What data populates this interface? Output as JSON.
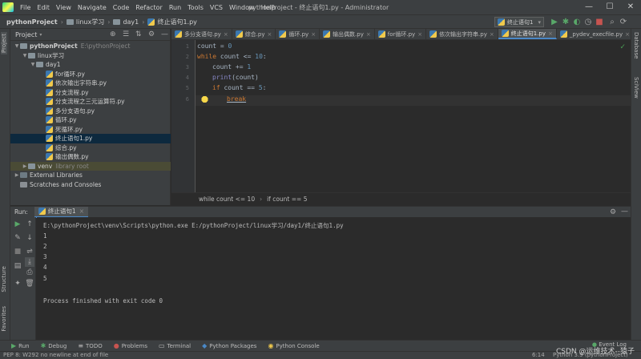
{
  "window": {
    "title": "pythonProject - 终止语句1.py - Administrator",
    "menu": [
      "File",
      "Edit",
      "View",
      "Navigate",
      "Code",
      "Refactor",
      "Run",
      "Tools",
      "VCS",
      "Window",
      "Help"
    ],
    "minimize": "—",
    "maximize": "☐",
    "close": "✕"
  },
  "navbar": {
    "crumbs": [
      "pythonProject",
      "linux学习",
      "day1",
      "终止语句1.py"
    ],
    "run_config": "终止语句1"
  },
  "project_panel": {
    "title": "Project",
    "root": "pythonProject",
    "root_path": "E:\\pythonProject",
    "folders": [
      "linux学习",
      "day1"
    ],
    "files": [
      "for循环.py",
      "依次输出字符串.py",
      "分支流程.py",
      "分支流程之三元运算符.py",
      "多分支语句.py",
      "循环.py",
      "死循环.py",
      "终止语句1.py",
      "综合.py",
      "输出偶数.py"
    ],
    "selected_file": "终止语句1.py",
    "venv": "venv",
    "venv_note": "library root",
    "external_libraries": "External Libraries",
    "scratches": "Scratches and Consoles"
  },
  "tool_windows": {
    "left_top": "Project",
    "left_structure": "Structure",
    "left_favorites": "Favorites",
    "right_db": "Database",
    "right_sciview": "SciView"
  },
  "editor_tabs": [
    {
      "label": "多分支语句.py",
      "active": false
    },
    {
      "label": "综合.py",
      "active": false
    },
    {
      "label": "循环.py",
      "active": false
    },
    {
      "label": "输出偶数.py",
      "active": false
    },
    {
      "label": "for循环.py",
      "active": false
    },
    {
      "label": "依次输出字符串.py",
      "active": false
    },
    {
      "label": "终止语句1.py",
      "active": true
    },
    {
      "label": "_pydev_execfile.py",
      "active": false
    }
  ],
  "code": {
    "line_numbers": [
      "1",
      "2",
      "3",
      "4",
      "5",
      "6"
    ],
    "l1_var": "count",
    "l1_eq": " = ",
    "l1_num": "0",
    "l2_kw": "while",
    "l2_rest": " count <= ",
    "l2_num": "10",
    "l2_colon": ":",
    "l3_rest": "count += ",
    "l3_num": "1",
    "l4_bi": "print",
    "l4_rest": "(count)",
    "l5_kw": "if",
    "l5_rest": " count == ",
    "l5_num": "5",
    "l5_colon": ":",
    "l6_kw": "break"
  },
  "editor_breadcrumb": {
    "a": "while count <= 10",
    "sep": "›",
    "b": "if count == 5"
  },
  "run_panel": {
    "label": "Run:",
    "tab": "终止语句1",
    "command": "E:\\pythonProject\\venv\\Scripts\\python.exe E:/pythonProject/linux学习/day1/终止语句1.py",
    "output": [
      "1",
      "2",
      "3",
      "4",
      "5"
    ],
    "exit_message": "Process finished with exit code 0"
  },
  "bottom_tools": [
    {
      "icon": "▶",
      "label": "Run"
    },
    {
      "icon": "✱",
      "label": "Debug"
    },
    {
      "icon": "≡",
      "label": "TODO"
    },
    {
      "icon": "●",
      "label": "Problems"
    },
    {
      "icon": "▭",
      "label": "Terminal"
    },
    {
      "icon": "◆",
      "label": "Python Packages"
    },
    {
      "icon": "◉",
      "label": "Python Console"
    }
  ],
  "event_log": "Event Log",
  "status": {
    "message": "PEP 8: W292 no newline at end of file",
    "position": "6:14",
    "interpreter": "Python 3.9 (pythonProject)"
  },
  "watermark": "CSDN @运维技术--猿子",
  "colors": {
    "accent": "#4a88c7",
    "keyword": "#cc7832",
    "number": "#6897bb",
    "builtin": "#8888c6"
  }
}
